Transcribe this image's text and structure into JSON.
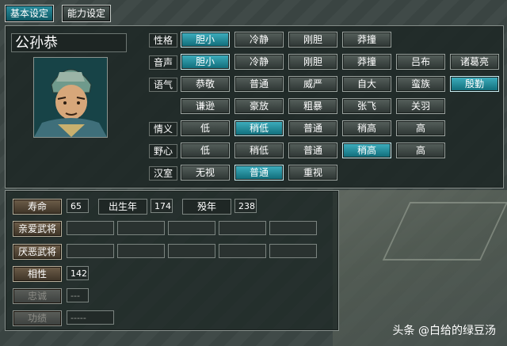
{
  "tabs": [
    "基本设定",
    "能力设定"
  ],
  "officer_name": "公孙恭",
  "rows": [
    {
      "label": "性格",
      "options": [
        "胆小",
        "冷静",
        "刚胆",
        "莽撞"
      ],
      "selected": 0
    },
    {
      "label": "音声",
      "options": [
        "胆小",
        "冷静",
        "刚胆",
        "莽撞",
        "吕布",
        "诸葛亮"
      ],
      "selected": 0
    },
    {
      "label": "语气",
      "options": [
        "恭敬",
        "普通",
        "威严",
        "自大",
        "蛮族",
        "殷勤"
      ],
      "selected": 5
    },
    {
      "label": "",
      "options": [
        "谦逊",
        "豪放",
        "粗暴",
        "张飞",
        "关羽"
      ],
      "selected": -1
    },
    {
      "label": "情义",
      "options": [
        "低",
        "稍低",
        "普通",
        "稍高",
        "高"
      ],
      "selected": 1
    },
    {
      "label": "野心",
      "options": [
        "低",
        "稍低",
        "普通",
        "稍高",
        "高"
      ],
      "selected": 3
    },
    {
      "label": "汉室",
      "options": [
        "无视",
        "普通",
        "重视"
      ],
      "selected": 1
    }
  ],
  "stats": {
    "lifespan_label": "寿命",
    "lifespan_value": "65",
    "birth_label": "出生年",
    "birth_value": "174",
    "death_label": "殁年",
    "death_value": "238",
    "liked_label": "亲爱武将",
    "disliked_label": "厌恶武将",
    "affinity_label": "相性",
    "affinity_value": "142",
    "loyalty_label": "忠诚",
    "loyalty_value": "---",
    "merit_label": "功绩",
    "merit_value": "-----"
  },
  "watermark": "头条 @白给的绿豆汤"
}
